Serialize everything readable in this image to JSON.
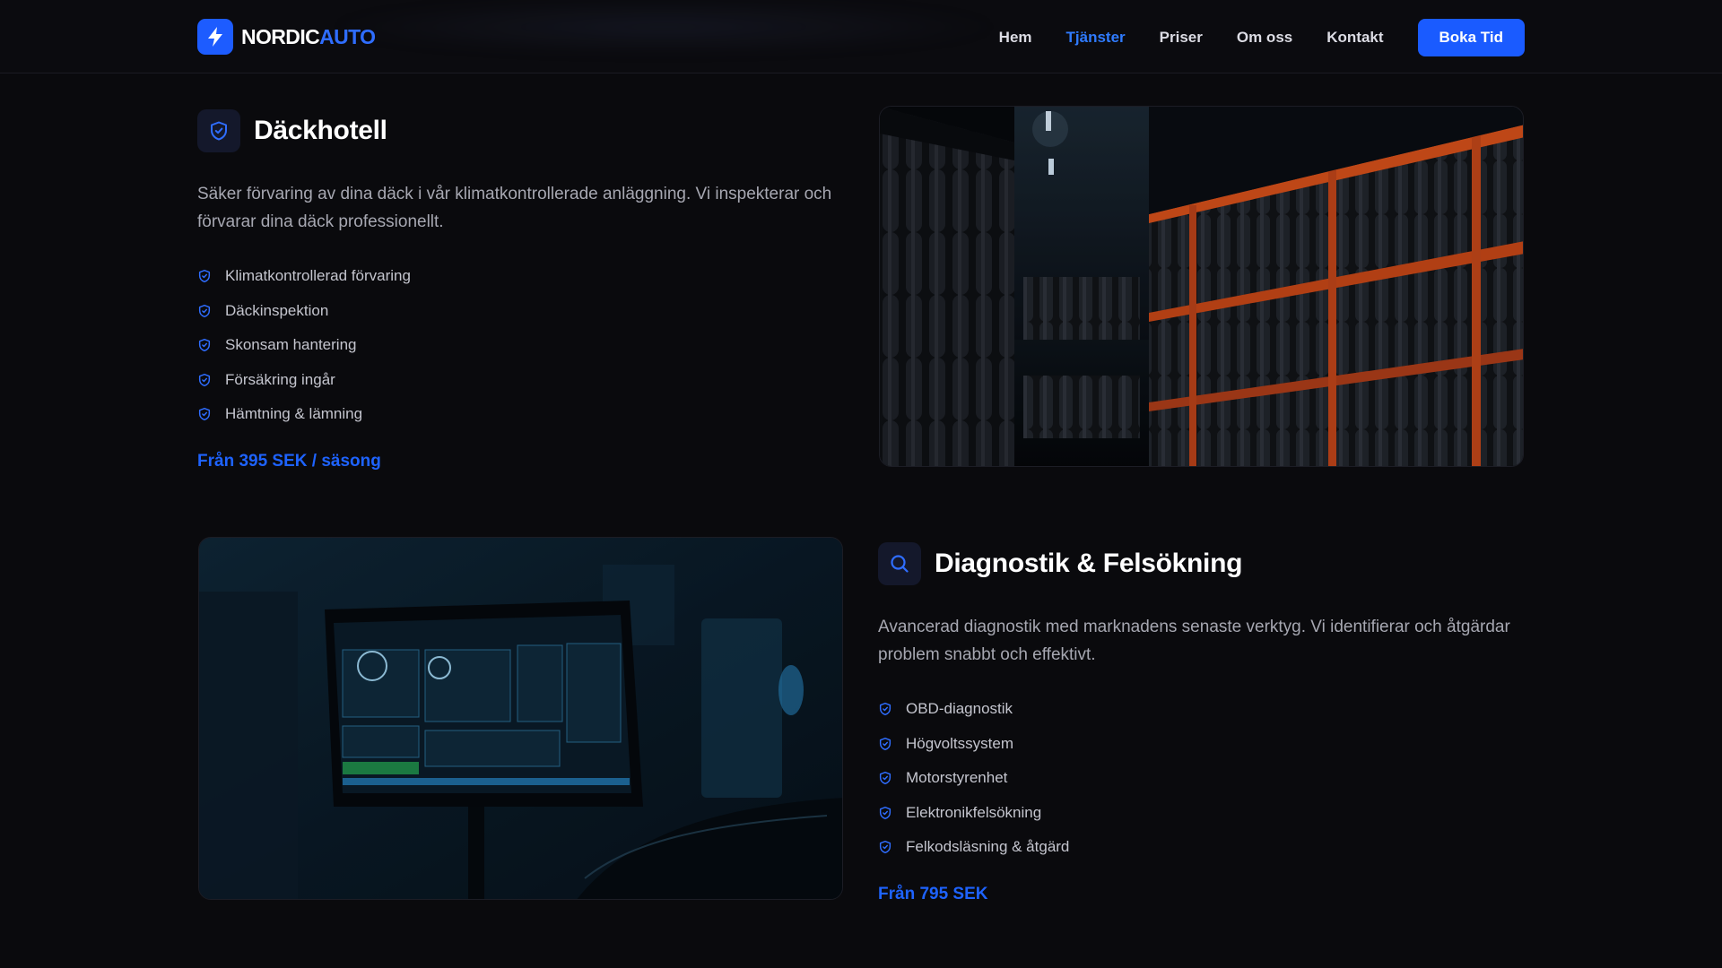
{
  "brand": {
    "part1": "NORDIC",
    "part2": "AUTO"
  },
  "nav": {
    "items": [
      {
        "label": "Hem"
      },
      {
        "label": "Tjänster"
      },
      {
        "label": "Priser"
      },
      {
        "label": "Om oss"
      },
      {
        "label": "Kontakt"
      }
    ],
    "active": "Tjänster",
    "cta_label": "Boka Tid"
  },
  "colors": {
    "accent": "#1a5bff",
    "background": "#0a0a0d",
    "text": "#ffffff",
    "muted": "#a6a7b1"
  },
  "services": [
    {
      "title": "Däckhotell",
      "icon": "shield-icon",
      "description": "Säker förvaring av dina däck i vår klimatkontrollerade anläggning. Vi inspekterar och förvarar dina däck professionellt.",
      "features": [
        "Klimatkontrollerad förvaring",
        "Däckinspektion",
        "Skonsam hantering",
        "Försäkring ingår",
        "Hämtning & lämning"
      ],
      "price": "Från 395 SEK / säsong",
      "image": "tire-storage-photo"
    },
    {
      "title": "Diagnostik & Felsökning",
      "icon": "search-icon",
      "description": "Avancerad diagnostik med marknadens senaste verktyg. Vi identifierar och åtgärdar problem snabbt och effektivt.",
      "features": [
        "OBD-diagnostik",
        "Högvoltssystem",
        "Motorstyrenhet",
        "Elektronikfelsökning",
        "Felkodsläsning & åtgärd"
      ],
      "price": "Från 795 SEK",
      "image": "diagnostic-screen-photo"
    }
  ]
}
